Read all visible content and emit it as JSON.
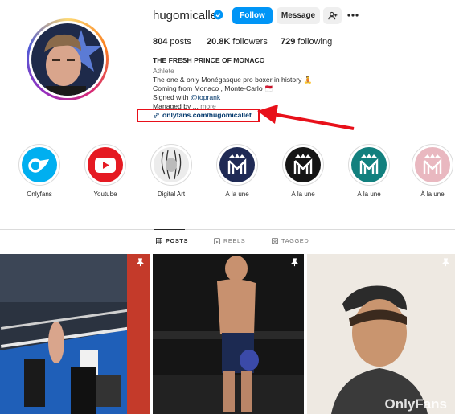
{
  "profile": {
    "username": "hugomicallef",
    "follow_label": "Follow",
    "message_label": "Message",
    "posts_count": "804",
    "posts_label": "posts",
    "followers_count": "20.8K",
    "followers_label": "followers",
    "following_count": "729",
    "following_label": "following"
  },
  "bio": {
    "name": "THE FRESH PRINCE OF MONACO",
    "category": "Athlete",
    "line1": "The one & only Monégasque pro boxer in history 🧘",
    "line2": "Coming from Monaco , Monte-Carlo 🇲🇨",
    "signed_prefix": "Signed with ",
    "signed_mention": "@toprank",
    "managed": "Managed by ... ",
    "more": "more",
    "link": "onlyfans.com/hugomicallef"
  },
  "highlights": [
    {
      "label": "Onlyfans"
    },
    {
      "label": "Youtube"
    },
    {
      "label": "Digital Art"
    },
    {
      "label": "À la une"
    },
    {
      "label": "À la une"
    },
    {
      "label": "À la une"
    },
    {
      "label": "À la une"
    }
  ],
  "tabs": {
    "posts": "POSTS",
    "reels": "REELS",
    "tagged": "TAGGED"
  },
  "grid": {
    "watermark": "OnlyFans"
  },
  "colors": {
    "accent": "#0095f6",
    "annotation": "#e8101a",
    "link": "#00376b"
  },
  "icons": [
    "verified-icon",
    "add-user-icon",
    "more-icon",
    "link-icon",
    "grid-icon",
    "reels-icon",
    "tagged-icon",
    "pin-icon"
  ]
}
